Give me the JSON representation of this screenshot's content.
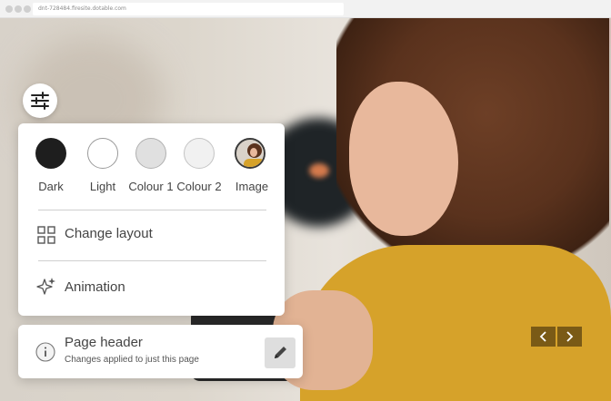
{
  "browser": {
    "url": "dnt-728484.firesite.dotable.com"
  },
  "settings_panel": {
    "swatches": [
      {
        "label": "Dark",
        "color": "#1e1e1e"
      },
      {
        "label": "Light",
        "color": "#ffffff"
      },
      {
        "label": "Colour 1",
        "color": "#e0e0e0"
      },
      {
        "label": "Colour 2",
        "color": "#f1f1f1"
      },
      {
        "label": "Image",
        "icon": "image-thumbnail"
      }
    ],
    "change_layout_label": "Change layout",
    "animation_label": "Animation"
  },
  "page_header": {
    "title": "Page header",
    "subtitle": "Changes applied to just this page"
  },
  "slider": {
    "prev_icon": "chevron-left-icon",
    "next_icon": "chevron-right-icon"
  },
  "colors": {
    "sweater": "#d6a22a",
    "arrow_bg": "#7a5a16"
  }
}
